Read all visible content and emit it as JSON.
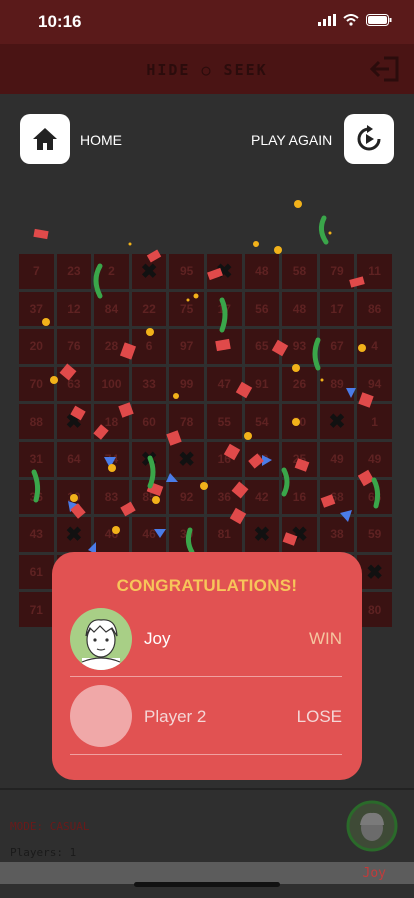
{
  "status_bar": {
    "time": "10:16"
  },
  "header": {
    "title": "HIDE ○ SEEK"
  },
  "nav": {
    "home_label": "HOME",
    "play_again_label": "PLAY AGAIN"
  },
  "board": {
    "cells": [
      {
        "n": "7"
      },
      {
        "n": "23"
      },
      {
        "n": "2"
      },
      {
        "n": "",
        "x": true
      },
      {
        "n": "95"
      },
      {
        "n": "",
        "x": true
      },
      {
        "n": "48"
      },
      {
        "n": "58"
      },
      {
        "n": "79"
      },
      {
        "n": "11"
      },
      {
        "n": "37"
      },
      {
        "n": "12"
      },
      {
        "n": "84"
      },
      {
        "n": "22"
      },
      {
        "n": "75"
      },
      {
        "n": "17"
      },
      {
        "n": "56"
      },
      {
        "n": "48"
      },
      {
        "n": "17"
      },
      {
        "n": "86"
      },
      {
        "n": "20"
      },
      {
        "n": "76"
      },
      {
        "n": "28"
      },
      {
        "n": "6"
      },
      {
        "n": "97"
      },
      {
        "n": "8"
      },
      {
        "n": "65"
      },
      {
        "n": "93"
      },
      {
        "n": "67"
      },
      {
        "n": "4"
      },
      {
        "n": "70"
      },
      {
        "n": "63"
      },
      {
        "n": "100"
      },
      {
        "n": "33"
      },
      {
        "n": "99"
      },
      {
        "n": "47"
      },
      {
        "n": "91"
      },
      {
        "n": "26"
      },
      {
        "n": "89"
      },
      {
        "n": "94"
      },
      {
        "n": "88"
      },
      {
        "n": "",
        "x": true
      },
      {
        "n": "18"
      },
      {
        "n": "60"
      },
      {
        "n": "78"
      },
      {
        "n": "55"
      },
      {
        "n": "54"
      },
      {
        "n": "50"
      },
      {
        "n": "",
        "x": true
      },
      {
        "n": "1"
      },
      {
        "n": "31"
      },
      {
        "n": "64"
      },
      {
        "n": "74"
      },
      {
        "n": "",
        "x": true
      },
      {
        "n": "",
        "x": true
      },
      {
        "n": "16"
      },
      {
        "n": "29"
      },
      {
        "n": "25"
      },
      {
        "n": "49"
      },
      {
        "n": "49"
      },
      {
        "n": "36"
      },
      {
        "n": "10"
      },
      {
        "n": "83"
      },
      {
        "n": "85"
      },
      {
        "n": "92"
      },
      {
        "n": "36"
      },
      {
        "n": "42"
      },
      {
        "n": "16"
      },
      {
        "n": "68"
      },
      {
        "n": "66"
      },
      {
        "n": "43"
      },
      {
        "n": "",
        "x": true
      },
      {
        "n": "46"
      },
      {
        "n": "46"
      },
      {
        "n": "30"
      },
      {
        "n": "81"
      },
      {
        "n": "",
        "x": true
      },
      {
        "n": "",
        "x": true
      },
      {
        "n": "38"
      },
      {
        "n": "59"
      },
      {
        "n": "61"
      },
      {
        "n": ""
      },
      {
        "n": ""
      },
      {
        "n": ""
      },
      {
        "n": ""
      },
      {
        "n": ""
      },
      {
        "n": ""
      },
      {
        "n": ""
      },
      {
        "n": ""
      },
      {
        "n": "",
        "x": true
      },
      {
        "n": "71"
      },
      {
        "n": ""
      },
      {
        "n": ""
      },
      {
        "n": ""
      },
      {
        "n": ""
      },
      {
        "n": ""
      },
      {
        "n": ""
      },
      {
        "n": ""
      },
      {
        "n": ""
      },
      {
        "n": "80"
      }
    ]
  },
  "modal": {
    "title": "CONGRATULATIONS!",
    "players": [
      {
        "name": "Joy",
        "result": "WIN"
      },
      {
        "name": "Player 2",
        "result": "LOSE"
      }
    ]
  },
  "footer": {
    "mode_text": "MODE: CASUAL",
    "players_text": "Players: 1",
    "current_player": "Joy"
  },
  "colors": {
    "accent_red": "#e15252",
    "gold": "#f7c55a",
    "board_cell": "#3a1212"
  }
}
